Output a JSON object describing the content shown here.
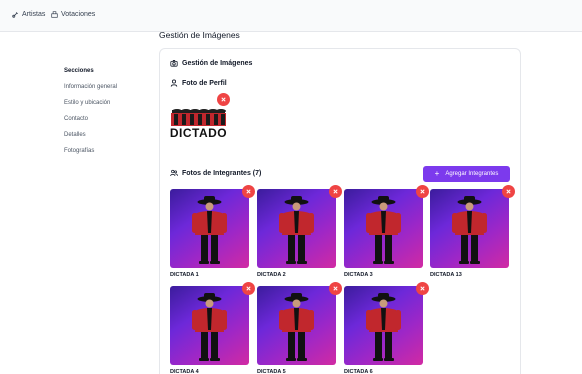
{
  "topbar": {
    "items": [
      {
        "label": "Artistas",
        "icon": "guitar-icon"
      },
      {
        "label": "Votaciones",
        "icon": "ballot-icon"
      }
    ]
  },
  "page": {
    "title": "Gestión de Imágenes"
  },
  "sidebar": {
    "heading": "Secciones",
    "items": [
      {
        "label": "Información general"
      },
      {
        "label": "Estilo y ubicación"
      },
      {
        "label": "Contacto"
      },
      {
        "label": "Detalles"
      },
      {
        "label": "Fotografías"
      }
    ]
  },
  "card": {
    "title": "Gestión de Imágenes",
    "profile": {
      "title": "Foto de Perfil",
      "logo_text": "DICTADO"
    },
    "members": {
      "title": "Fotos de Integrantes (7)",
      "add_label": "Agregar Integrantes",
      "items": [
        {
          "name": "DICTADA 1"
        },
        {
          "name": "DICTADA 2"
        },
        {
          "name": "DICTADA 3"
        },
        {
          "name": "DICTADA 13"
        },
        {
          "name": "DICTADA 4"
        },
        {
          "name": "DICTADA 5"
        },
        {
          "name": "DICTADA 6"
        }
      ]
    }
  },
  "colors": {
    "accent": "#7c3aed",
    "danger": "#ef4444",
    "jacket": "#c1272d"
  }
}
